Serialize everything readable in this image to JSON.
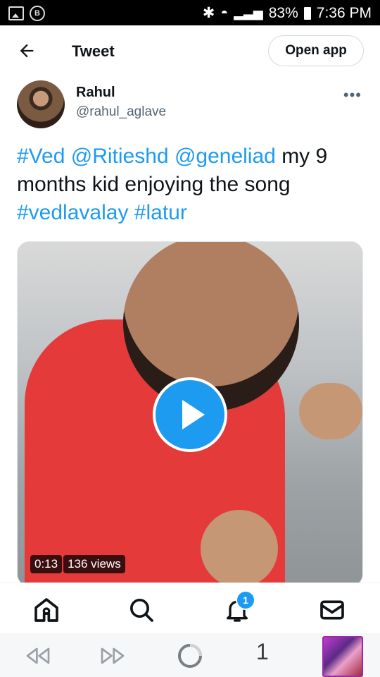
{
  "status_bar": {
    "battery": "83%",
    "time": "7:36 PM"
  },
  "header": {
    "title": "Tweet",
    "open_app_label": "Open app"
  },
  "tweet": {
    "author_name": "Rahul",
    "author_handle": "@rahul_aglave",
    "text_parts": [
      {
        "text": "#Ved",
        "type": "link"
      },
      {
        "text": " ",
        "type": "plain"
      },
      {
        "text": "@Ritieshd",
        "type": "link"
      },
      {
        "text": " ",
        "type": "plain"
      },
      {
        "text": "@geneliad",
        "type": "link"
      },
      {
        "text": " my 9 months kid enjoying the song ",
        "type": "plain"
      },
      {
        "text": "#vedlavalay",
        "type": "link"
      },
      {
        "text": " ",
        "type": "plain"
      },
      {
        "text": "#latur",
        "type": "link"
      }
    ],
    "video_duration": "0:13",
    "video_views": "136 views"
  },
  "nav": {
    "notifications_count": "1"
  },
  "system_bar": {
    "tab_count": "1"
  },
  "colors": {
    "accent": "#1d9bf0"
  }
}
